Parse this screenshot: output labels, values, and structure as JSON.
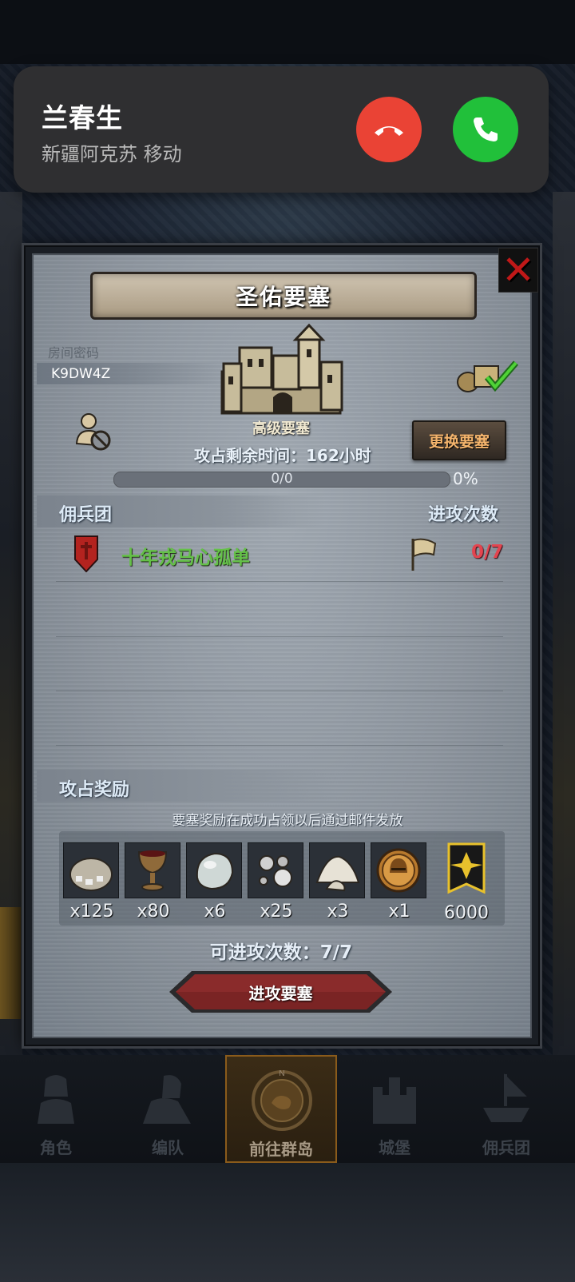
{
  "call": {
    "caller_name": "兰春生",
    "caller_location": "新疆阿克苏 移动",
    "decline_color": "#ea4335",
    "accept_color": "#21c03a"
  },
  "dialog": {
    "title": "圣佑要塞",
    "room_label": "房间密码",
    "room_code": "K9DW4Z",
    "fortress_type": "高级要塞",
    "change_button": "更换要塞",
    "time_label": "攻占剩余时间：162小时",
    "progress": {
      "value": 0,
      "text": "0/0",
      "percent_text": "0%"
    },
    "guild_section": {
      "title": "佣兵团",
      "attacks_header": "进攻次数"
    },
    "guilds": [
      {
        "name": "十年戎马心孤单",
        "attacks": "0/7"
      }
    ],
    "reward_section": {
      "title": "攻占奖励",
      "note": "要塞奖励在成功占领以后通过邮件发放",
      "items": [
        {
          "icon": "ore-sack-icon",
          "qty": "x125"
        },
        {
          "icon": "goblet-icon",
          "qty": "x80"
        },
        {
          "icon": "moonstone-icon",
          "qty": "x6"
        },
        {
          "icon": "silver-pebbles-icon",
          "qty": "x25"
        },
        {
          "icon": "salt-pile-icon",
          "qty": "x3"
        },
        {
          "icon": "knight-helmet-coin-icon",
          "qty": "x1"
        },
        {
          "icon": "honor-banner-icon",
          "qty": "6000"
        }
      ]
    },
    "attacks_left": "可进攻次数：7/7",
    "attack_button": "进攻要塞"
  },
  "nav": {
    "items": [
      {
        "label": "角色",
        "icon": "knight-icon",
        "active": false
      },
      {
        "label": "编队",
        "icon": "formation-icon",
        "active": false
      },
      {
        "label": "前往群岛",
        "icon": "compass-map-icon",
        "active": true,
        "compass_letter": "N"
      },
      {
        "label": "城堡",
        "icon": "castle-icon",
        "active": false
      },
      {
        "label": "佣兵团",
        "icon": "ship-icon",
        "active": false
      }
    ]
  }
}
